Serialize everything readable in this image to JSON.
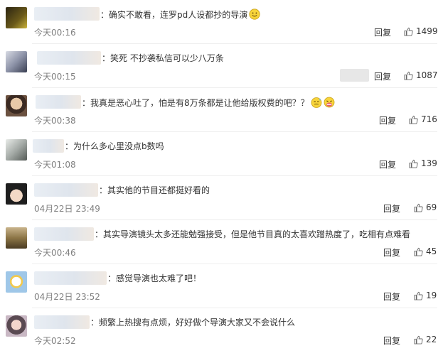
{
  "comments": [
    {
      "text": "：确实不敢看，连罗pd人设都抄的导演",
      "time": "今天00:16",
      "reply": "回复",
      "likes": "1499",
      "emoji": "smile-emoji-icon"
    },
    {
      "text": "：笑死 不抄袭私信可以少八万条",
      "time": "今天00:15",
      "reply": "回复",
      "likes": "1087"
    },
    {
      "text": "：我真是恶心吐了，怕是有8万条都是让他给版权费的吧？？",
      "time": "今天00:38",
      "reply": "回复",
      "likes": "716",
      "emoji": "sweat-emoji-icon"
    },
    {
      "text": "：为什么多心里没点b数吗",
      "time": "今天01:08",
      "reply": "回复",
      "likes": "139"
    },
    {
      "text": "：其实他的节目还都挺好看的",
      "time": "04月22日 23:49",
      "reply": "回复",
      "likes": "69"
    },
    {
      "text": "：其实导演镜头太多还能勉强接受，但是他节目真的太喜欢蹭热度了，吃相有点难看",
      "time": "今天00:46",
      "reply": "回复",
      "likes": "45"
    },
    {
      "text": "：感觉导演也太难了吧！",
      "time": "04月22日 23:52",
      "reply": "回复",
      "likes": "19"
    },
    {
      "text": "：频繁上热搜有点烦，好好做个导演大家又不会说什么",
      "time": "今天02:52",
      "reply": "回复",
      "likes": "22"
    }
  ],
  "colors": {
    "text": "#333333",
    "time": "#808080",
    "separator": "#eeeeee"
  }
}
